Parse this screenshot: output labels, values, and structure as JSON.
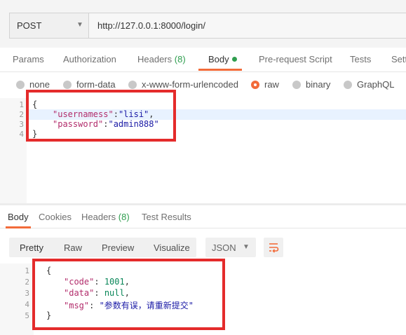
{
  "request": {
    "method": "POST",
    "url": "http://127.0.0.1:8000/login/"
  },
  "request_tabs": {
    "params": "Params",
    "authorization": "Authorization",
    "headers": "Headers",
    "headers_count": "(8)",
    "body": "Body",
    "prerequest": "Pre-request Script",
    "tests": "Tests",
    "settings": "Setti"
  },
  "body_types": {
    "none": "none",
    "form_data": "form-data",
    "urlencoded": "x-www-form-urlencoded",
    "raw": "raw",
    "binary": "binary",
    "graphql": "GraphQL",
    "selected": "raw"
  },
  "editor": {
    "line_numbers": [
      "1",
      "2",
      "3",
      "4"
    ],
    "line1": "{",
    "l2_key": "\"usernamess\"",
    "l2_colon": ":",
    "l2_value": "\"lisi\"",
    "l2_comma": ",",
    "l3_key": "\"password\"",
    "l3_colon": ":",
    "l3_value": "\"admin888\"",
    "line4": "}"
  },
  "response_tabs": {
    "body": "Body",
    "cookies": "Cookies",
    "headers": "Headers",
    "headers_count": "(8)",
    "test_results": "Test Results"
  },
  "view_modes": {
    "pretty": "Pretty",
    "raw": "Raw",
    "preview": "Preview",
    "visualize": "Visualize",
    "format": "JSON"
  },
  "response": {
    "line_numbers": [
      "1",
      "2",
      "3",
      "4",
      "5"
    ],
    "line1": "{",
    "l2_key": "\"code\"",
    "l2_sep": ": ",
    "l2_value": "1001",
    "l2_comma": ",",
    "l3_key": "\"data\"",
    "l3_sep": ": ",
    "l3_value": "null",
    "l3_comma": ",",
    "l4_key": "\"msg\"",
    "l4_sep": ": ",
    "l4_value": "\"参数有误，请重新提交\"",
    "line5": "}"
  },
  "colors": {
    "accent": "#f26b3a",
    "count_green": "#2f9e4f",
    "annotation_red": "#e42b2b"
  }
}
